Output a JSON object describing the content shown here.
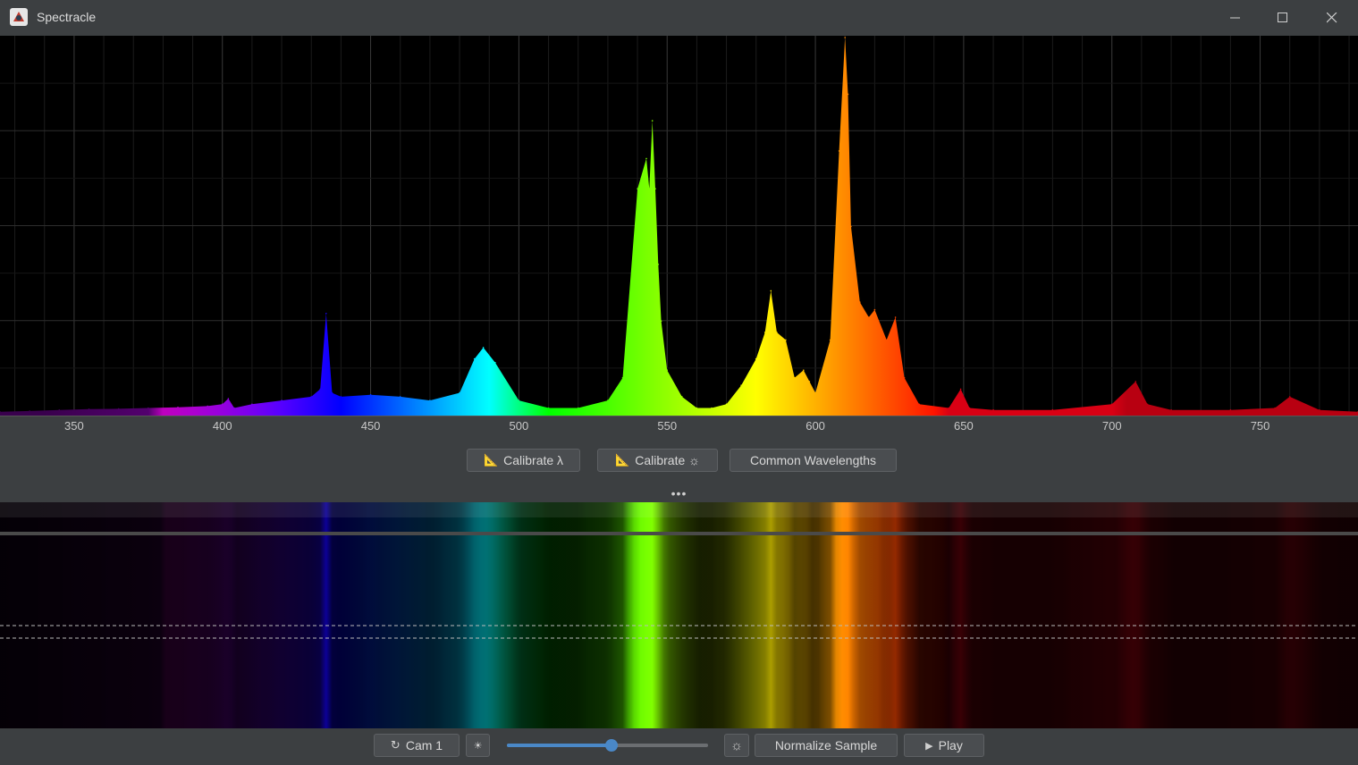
{
  "window": {
    "title": "Spectracle",
    "controls": [
      "minimize",
      "maximize",
      "close"
    ]
  },
  "toolbar": {
    "calibrate_wavelength": "Calibrate λ",
    "calibrate_intensity": "Calibrate ☼",
    "common_wavelengths": "Common Wavelengths",
    "splitter": "•••"
  },
  "bottom": {
    "camera_label": "Cam 1",
    "camera_icon": "refresh-icon",
    "brightness_low_icon": "brightness-low-icon",
    "brightness_high_icon": "brightness-high-icon",
    "slider_fraction": 0.52,
    "normalize_label": "Normalize Sample",
    "play_label": "Play",
    "play_icon": "play-icon"
  },
  "chart_data": {
    "type": "area",
    "title": "",
    "xlabel": "",
    "ylabel": "",
    "x_ticks": [
      "350",
      "400",
      "450",
      "500",
      "550",
      "600",
      "650",
      "700",
      "750"
    ],
    "xlim": [
      325,
      783
    ],
    "ylim": [
      0,
      1
    ],
    "grid": true,
    "colored_by_wavelength": true,
    "x": [
      325,
      335,
      345,
      355,
      365,
      375,
      385,
      395,
      400,
      402,
      404,
      410,
      420,
      430,
      433,
      435,
      437,
      440,
      450,
      460,
      470,
      480,
      485,
      488,
      492,
      500,
      510,
      520,
      530,
      535,
      540,
      543,
      544,
      545,
      546,
      547,
      548,
      550,
      555,
      560,
      565,
      570,
      575,
      580,
      583,
      585,
      587,
      590,
      593,
      596,
      598,
      600,
      605,
      608,
      610,
      611,
      612,
      615,
      618,
      620,
      624,
      627,
      630,
      635,
      645,
      649,
      652,
      660,
      680,
      700,
      708,
      712,
      720,
      740,
      755,
      760,
      770,
      783
    ],
    "values": [
      0.01,
      0.012,
      0.015,
      0.017,
      0.018,
      0.02,
      0.022,
      0.025,
      0.03,
      0.045,
      0.02,
      0.03,
      0.04,
      0.05,
      0.07,
      0.27,
      0.06,
      0.05,
      0.055,
      0.05,
      0.04,
      0.06,
      0.15,
      0.18,
      0.14,
      0.04,
      0.02,
      0.02,
      0.04,
      0.1,
      0.6,
      0.68,
      0.6,
      0.78,
      0.6,
      0.4,
      0.25,
      0.12,
      0.05,
      0.02,
      0.02,
      0.03,
      0.08,
      0.15,
      0.22,
      0.33,
      0.22,
      0.2,
      0.1,
      0.12,
      0.09,
      0.06,
      0.2,
      0.7,
      1.0,
      0.85,
      0.5,
      0.3,
      0.26,
      0.28,
      0.2,
      0.26,
      0.1,
      0.03,
      0.02,
      0.07,
      0.02,
      0.015,
      0.015,
      0.03,
      0.09,
      0.03,
      0.015,
      0.015,
      0.02,
      0.05,
      0.015,
      0.01
    ]
  }
}
